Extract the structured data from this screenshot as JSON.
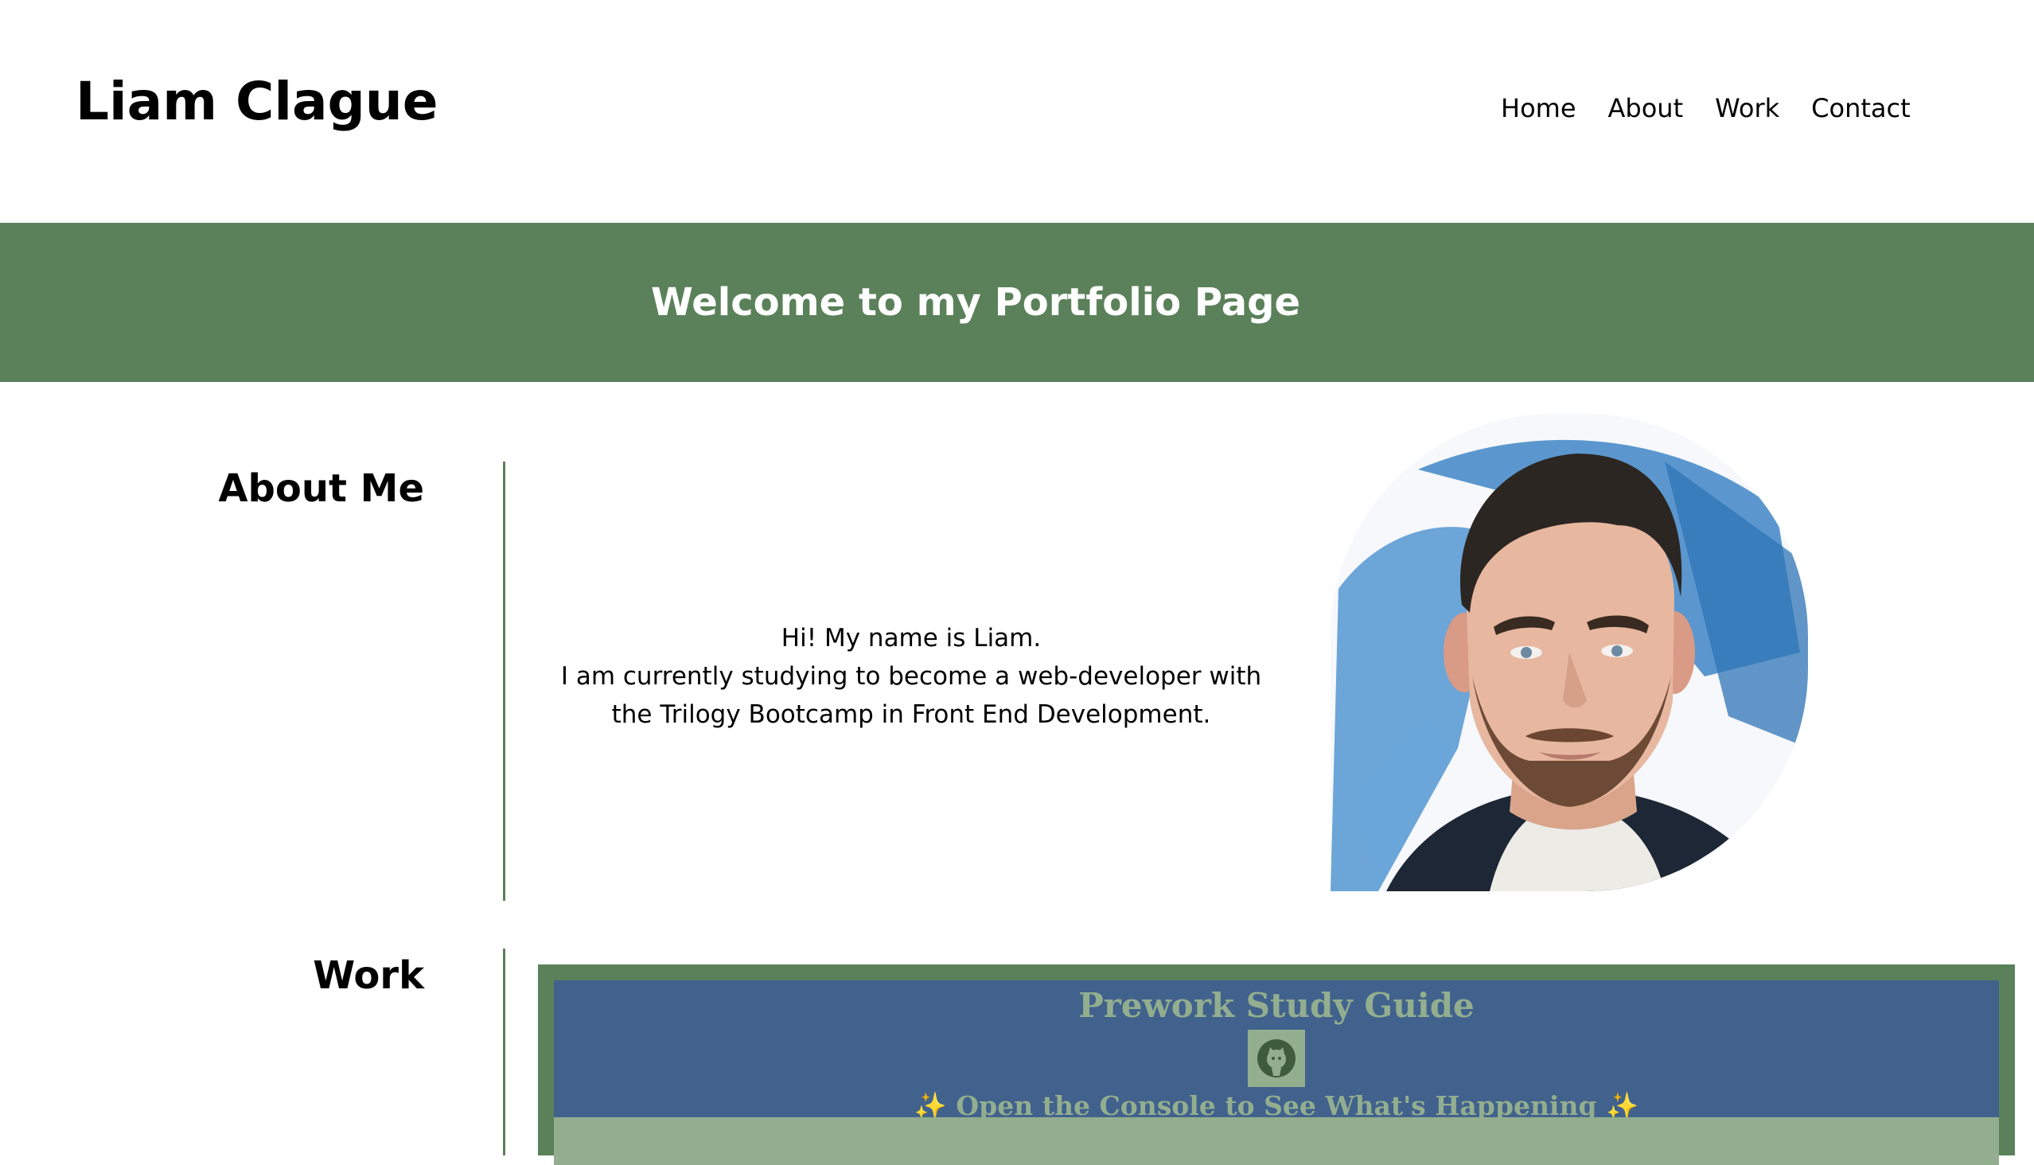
{
  "header": {
    "site_title": "Liam Clague",
    "nav": [
      "Home",
      "About",
      "Work",
      "Contact"
    ]
  },
  "banner": {
    "text": "Welcome to my Portfolio Page"
  },
  "about": {
    "heading": "About Me",
    "lines": [
      "Hi! My name is Liam.",
      "I am currently studying to become a web-developer with",
      "the Trilogy Bootcamp in Front End Development."
    ],
    "portrait_icon": "portrait-illustration"
  },
  "work": {
    "heading": "Work",
    "project": {
      "title": "Prework Study Guide",
      "logo_icon": "github-cat-icon",
      "subtitle": "✨ Open the Console to See What's Happening ✨"
    }
  },
  "colors": {
    "accent": "#5b815a",
    "project_blue": "#41628c",
    "project_sage": "#93ae8f"
  }
}
